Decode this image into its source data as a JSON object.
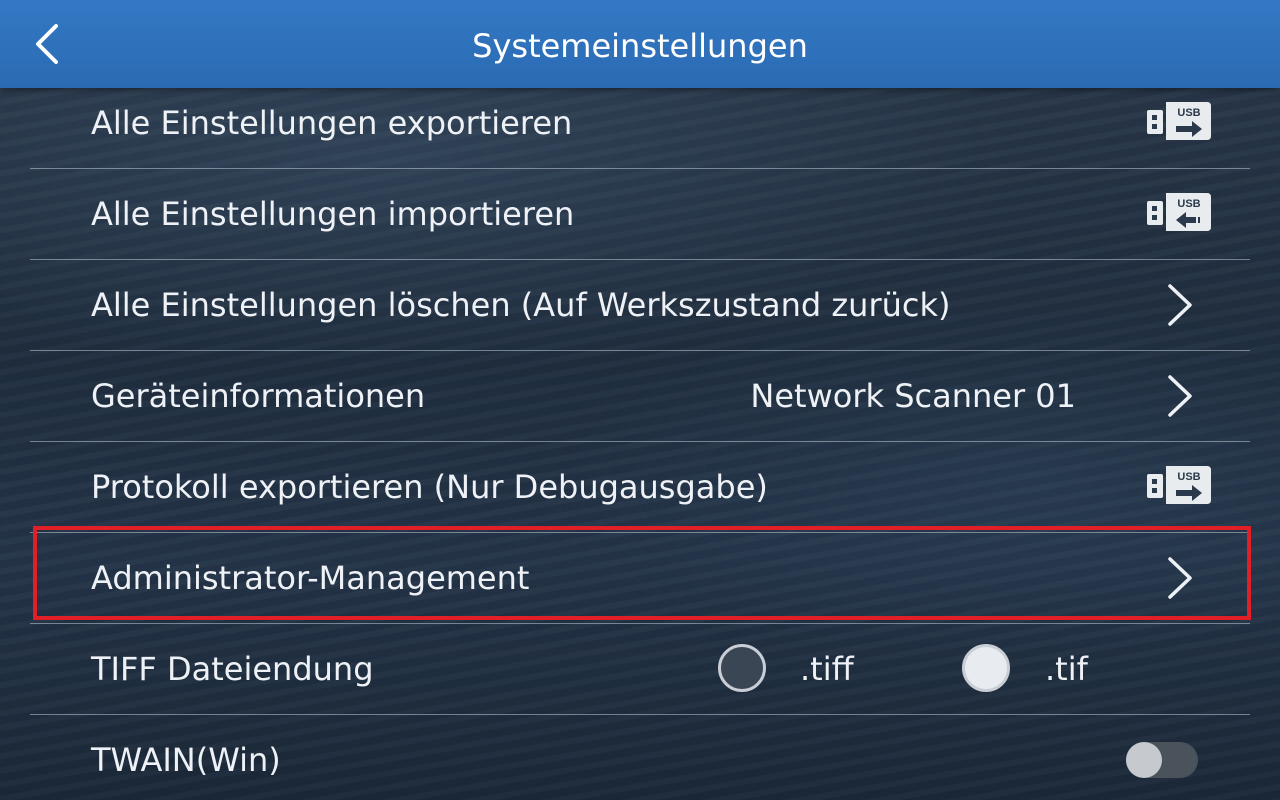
{
  "header": {
    "title": "Systemeinstellungen",
    "back_icon": "chevron-left-icon"
  },
  "rows": [
    {
      "label": "Alle Einstellungen exportieren",
      "trailing": "usb-export-icon",
      "usb_text": "USB"
    },
    {
      "label": "Alle Einstellungen importieren",
      "trailing": "usb-import-icon",
      "usb_text": "USB"
    },
    {
      "label": "Alle Einstellungen löschen (Auf Werkszustand zurück)",
      "trailing": "chevron-right-icon"
    },
    {
      "label": "Geräteinformationen",
      "value": "Network Scanner 01",
      "trailing": "chevron-right-icon"
    },
    {
      "label": "Protokoll exportieren (Nur Debugausgabe)",
      "trailing": "usb-export-icon",
      "usb_text": "USB"
    },
    {
      "label": "Administrator-Management",
      "trailing": "chevron-right-icon",
      "highlighted": true
    },
    {
      "label": "TIFF Dateiendung",
      "options": [
        {
          "label": ".tiff",
          "selected": false
        },
        {
          "label": ".tif",
          "selected": true
        }
      ]
    },
    {
      "label": "TWAIN(Win)",
      "toggle_on": false
    }
  ],
  "colors": {
    "header": "#2f72bd",
    "highlight": "#e21f26",
    "divider": "#bec8d7"
  }
}
